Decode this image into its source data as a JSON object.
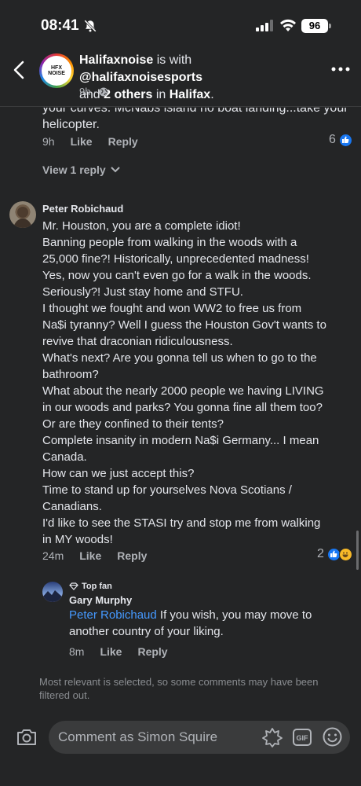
{
  "status_bar": {
    "time": "08:41",
    "battery": "96"
  },
  "header": {
    "page_name": "Halifaxnoise",
    "text1": " is with ",
    "tagged": "@halifaxnoisesports",
    "text2": "and ",
    "others": "2 others",
    "text3": " in ",
    "place": "Halifax",
    "text4": ".",
    "time": "9h",
    "dot": "·",
    "avatar_text1": "HFX",
    "avatar_text2": "NOISE"
  },
  "prev_comment": {
    "text_partial": "your curves. McNabs island no boat landing...take your",
    "text_last": "helicopter.",
    "time": "9h",
    "like": "Like",
    "reply": "Reply",
    "reactions": "6",
    "view_replies": "View 1 reply"
  },
  "comment": {
    "author": "Peter Robichaud",
    "lines": [
      "Mr. Houston, you are a complete idiot!",
      "Banning people from walking in the woods with a",
      "25,000 fine?! Historically, unprecedented madness!",
      "Yes, now you can't even go for a walk in the woods.",
      "Seriously?! Just stay home and STFU.",
      "I thought we fought and won WW2 to free us from",
      "Na$i tyranny? Well I guess the Houston Gov't wants to",
      "revive that draconian ridiculousness.",
      "What's next? Are you gonna tell us when to go to the",
      "bathroom?",
      "What about the nearly 2000 people we having LIVING",
      "in our woods and parks? You gonna fine all them too?",
      "Or are they confined to their tents?",
      "Complete insanity in modern Na$i Germany... I mean",
      "Canada.",
      "How can we just accept this?",
      "Time to stand up for yourselves Nova Scotians /",
      "Canadians.",
      "I'd like to see the STASI try and stop me from walking",
      "in MY woods!"
    ],
    "time": "24m",
    "like": "Like",
    "reply": "Reply",
    "reactions": "2"
  },
  "reply": {
    "badge": "Top fan",
    "author": "Gary Murphy",
    "mention": "Peter Robichaud",
    "text1": " If you wish, you may move to",
    "text2": "another country of your liking.",
    "time": "8m",
    "like": "Like",
    "reply": "Reply"
  },
  "filter_note": "Most relevant is selected, so some comments may have been filtered out.",
  "composer": {
    "placeholder": "Comment as Simon Squire",
    "gif": "GIF"
  },
  "colors": {
    "background": "#242526",
    "link": "#4599ff",
    "like": "#1877f2"
  }
}
